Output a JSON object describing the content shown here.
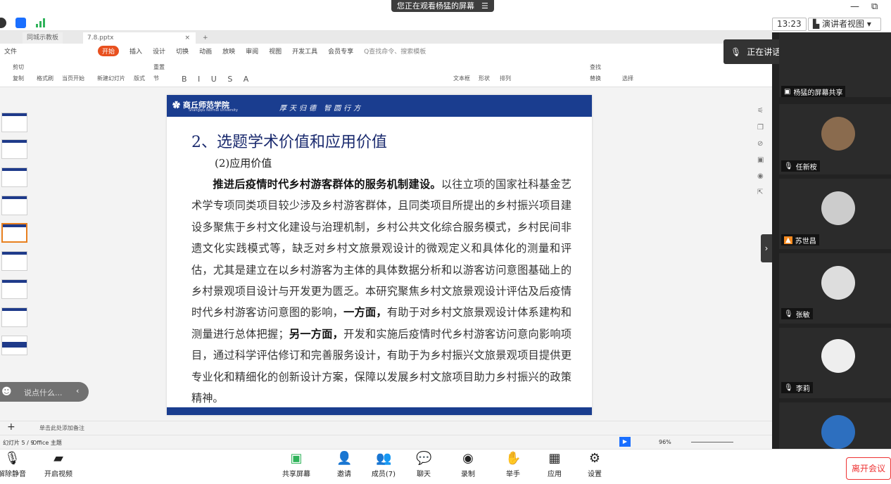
{
  "screen_share": {
    "viewing_label": "您正在观看杨猛的屏幕",
    "menu_icon": "☰"
  },
  "presenter": {
    "clock": "13:23",
    "view_mode": "演讲者视图"
  },
  "wps": {
    "tabs": [
      "同城示教板",
      "7.8.pptx"
    ],
    "menu": [
      "文件",
      "开始",
      "插入",
      "设计",
      "切换",
      "动画",
      "放映",
      "审阅",
      "视图",
      "开发工具",
      "会员专享"
    ],
    "search_placeholder": "Q查找命令、搜索模板",
    "ribbon": [
      "剪切",
      "复制",
      "格式刷",
      "当页开始",
      "新建幻灯片",
      "版式",
      "节",
      "重置",
      "文本框",
      "形状",
      "排列",
      "查找",
      "替换",
      "选择"
    ],
    "notes_placeholder": "单击此处添加备注",
    "status_left": "幻灯片 5 / 9",
    "status_theme": "Office 主题",
    "zoom": "96%"
  },
  "slide": {
    "school": "商丘师范学院",
    "school_en": "Shangqiu Normal University",
    "motto": "厚天归德  智圆行方",
    "title": "2、选题学术价值和应用价值",
    "subtitle": "(2)应用价值",
    "body_bold1": "推进后疫情时代乡村游客群体的服务机制建设。",
    "body1": "以往立项的国家社科基金艺术学专项同类项目较少涉及乡村游客群体，且同类项目所提出的乡村振兴项目建设多聚焦于乡村文化建设与治理机制，乡村公共文化综合服务模式，乡村民间非遗文化实践模式等，缺乏对乡村文旅景观设计的微观定义和具体化的测量和评估，尤其是建立在以乡村游客为主体的具体数据分析和以游客访问意图基础上的乡村景观项目设计与开发更为匮乏。本研究聚焦乡村文旅景观设计评估及后疫情时代乡村游客访问意图的影响，",
    "body_bold2": "一方面，",
    "body2": "有助于对乡村文旅景观设计体系建构和测量进行总体把握；",
    "body_bold3": "另一方面，",
    "body3": "开发和实施后疫情时代乡村游客访问意向影响项目，通过科学评估修订和完善服务设计，有助于为乡村振兴文旅景观项目提供更专业化和精细化的创新设计方案，保障以发展乡村文旅项目助力乡村振兴的政策精神。"
  },
  "chat": {
    "placeholder": "说点什么..."
  },
  "speaking": {
    "label": "正在讲话: 杨猛"
  },
  "participants": [
    {
      "name": "杨猛的屏幕共享"
    },
    {
      "name": "任新桉"
    },
    {
      "name": "苏世昌"
    },
    {
      "name": "张敏"
    },
    {
      "name": "李莉"
    }
  ],
  "toolbar": {
    "mute": "解除静音",
    "video": "开启视频",
    "share": "共享屏幕",
    "invite": "邀请",
    "members": "成员(7)",
    "chat": "聊天",
    "record": "录制",
    "raise": "举手",
    "apps": "应用",
    "settings": "设置",
    "leave": "离开会议"
  }
}
